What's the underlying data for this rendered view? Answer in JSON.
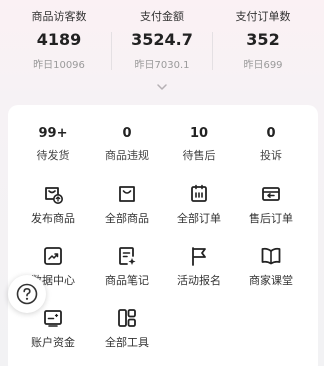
{
  "stats": [
    {
      "label": "商品访客数",
      "value": "4189",
      "prev": "昨日10096"
    },
    {
      "label": "支付金额",
      "value": "3524.7",
      "prev": "昨日7030.1"
    },
    {
      "label": "支付订单数",
      "value": "352",
      "prev": "昨日699"
    }
  ],
  "order_status": [
    {
      "value": "99+",
      "label": "待发货"
    },
    {
      "value": "0",
      "label": "商品违规"
    },
    {
      "value": "10",
      "label": "待售后"
    },
    {
      "value": "0",
      "label": "投诉"
    }
  ],
  "tools": [
    {
      "label": "发布商品",
      "icon": "publish-product-icon"
    },
    {
      "label": "全部商品",
      "icon": "bag-icon"
    },
    {
      "label": "全部订单",
      "icon": "order-list-icon"
    },
    {
      "label": "售后订单",
      "icon": "after-sales-icon"
    },
    {
      "label": "数据中心",
      "icon": "trend-chart-icon"
    },
    {
      "label": "商品笔记",
      "icon": "note-icon"
    },
    {
      "label": "活动报名",
      "icon": "flag-icon"
    },
    {
      "label": "商家课堂",
      "icon": "book-icon"
    },
    {
      "label": "账户资金",
      "icon": "wallet-icon"
    },
    {
      "label": "全部工具",
      "icon": "tools-grid-icon"
    }
  ],
  "colors": {
    "accent": "#222222",
    "muted": "#9a9a9a",
    "card": "#ffffff"
  }
}
